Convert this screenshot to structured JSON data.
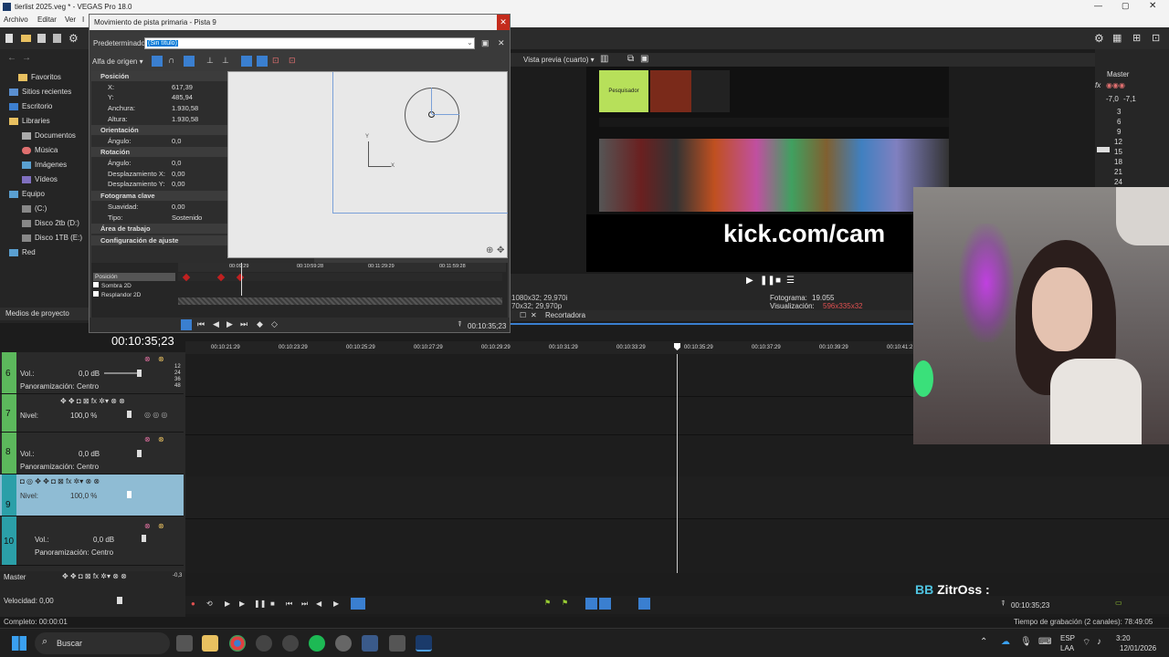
{
  "window": {
    "title": "tierlist 2025.veg * - VEGAS Pro 18.0"
  },
  "menu": [
    "Archivo",
    "Editar",
    "Ver",
    "I"
  ],
  "explorer": {
    "items": [
      "Favoritos",
      "Sitios recientes",
      "Escritorio",
      "Libraries",
      "Documentos",
      "Música",
      "Imágenes",
      "Vídeos",
      "Equipo",
      "(C:)",
      "Disco 2tb (D:)",
      "Disco 1TB (E:)",
      "Red"
    ],
    "footer_tab": "Medios de proyecto"
  },
  "dialog": {
    "title": "Movimiento de pista primaria - Pista 9",
    "preset_label": "Predeterminado:",
    "preset_value": "(Sin título)",
    "origin_label": "Alfa de origen",
    "sections": {
      "position": "Posición",
      "orientation": "Orientación",
      "rotation": "Rotación",
      "keyframe": "Fotograma clave",
      "work_area": "Área de trabajo",
      "settings": "Configuración de ajuste"
    },
    "props": {
      "x_label": "X:",
      "x_value": "617,39",
      "y_label": "Y:",
      "y_value": "485,94",
      "width_label": "Anchura:",
      "width_value": "1.930,58",
      "height_label": "Altura:",
      "height_value": "1.930,58",
      "angle_label": "Ángulo:",
      "angle_value": "0,0",
      "rot_angle_label": "Ángulo:",
      "rot_angle_value": "0,0",
      "offset_x_label": "Desplazamiento X:",
      "offset_x_value": "0,00",
      "offset_y_label": "Desplazamiento Y:",
      "offset_y_value": "0,00",
      "smooth_label": "Suavidad:",
      "smooth_value": "0,00",
      "type_label": "Tipo:",
      "type_value": "Sostenido"
    },
    "axis_x": "X",
    "axis_y": "Y",
    "keyframe_tracks": [
      "Posición",
      "Sombra 2D",
      "Resplandor 2D"
    ],
    "kf_times": [
      "00:09:29",
      "00:10:59:28",
      "00:11:29:29",
      "00:11:59:28"
    ],
    "timecode": "00:10:35;23"
  },
  "preview": {
    "mode": "Vista previa (cuarto)",
    "overlay_text": "kick.com/cam",
    "tier_label": "Pesquisador",
    "project_info": "1080x32; 29,970i",
    "preview_info": "70x32; 29,970p",
    "frame_label": "Fotograma:",
    "frame_value": "19.055",
    "display_label": "Visualización:",
    "display_value": "596x335x32",
    "tab_crop": "Recortadora"
  },
  "master_bus": {
    "label": "Master",
    "left_db": "-7,0",
    "right_db": "-7,1",
    "scale": [
      "3",
      "6",
      "9",
      "12",
      "15",
      "18",
      "21",
      "24"
    ]
  },
  "timeline": {
    "cursor_time": "00:10:35;23",
    "ruler": [
      "00:10:21:29",
      "00:10:23:29",
      "00:10:25:29",
      "00:10:27:29",
      "00:10:29:29",
      "00:10:31:29",
      "00:10:33:29",
      "00:10:35:29",
      "00:10:37:29",
      "00:10:39:29",
      "00:10:41:2"
    ],
    "tracks": [
      {
        "num": "6",
        "vol_label": "Vol.:",
        "vol": "0,0 dB",
        "pan_label": "Panoramización:",
        "pan": "Centro"
      },
      {
        "num": "7",
        "level_label": "Nivel:",
        "level": "100,0 %"
      },
      {
        "num": "8",
        "vol_label": "Vol.:",
        "vol": "0,0 dB",
        "pan_label": "Panoramización:",
        "pan": "Centro"
      },
      {
        "num": "9",
        "level_label": "Nivel:",
        "level": "100,0 %"
      },
      {
        "num": "10",
        "vol_label": "Vol.:",
        "vol": "0,0 dB",
        "pan_label": "Panoramización:",
        "pan": "Centro"
      }
    ],
    "meter": [
      "12",
      "24",
      "36",
      "48"
    ],
    "master_label": "Master",
    "master_level": "-0,3",
    "speed_label": "Velocidad: 0,00",
    "transport_time": "00:10:35;23",
    "stream_label": "ZitrOss :"
  },
  "status": {
    "left": "Completo: 00:00:01",
    "right": "Tiempo de grabación (2 canales): 78:49:05"
  },
  "taskbar": {
    "search": "Buscar",
    "lang1": "ESP",
    "lang2": "LAA",
    "time": "3:20",
    "date": "12/01/2026"
  },
  "colors": {
    "accent": "#0078d7",
    "track_green": "#5cb85c",
    "track_teal": "#2b9fa8",
    "track_selected": "#8fbcd4",
    "close_red": "#c42b1c"
  }
}
